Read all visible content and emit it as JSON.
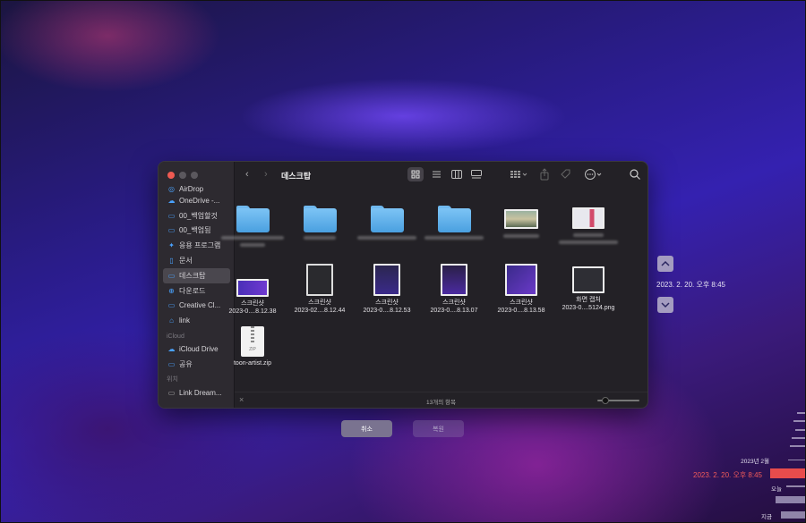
{
  "finder": {
    "title": "데스크탑",
    "sidebar": {
      "favorites": [
        {
          "label": "AirDrop",
          "icon": "airdrop-icon"
        },
        {
          "label": "OneDrive -...",
          "icon": "cloud-icon"
        },
        {
          "label": "00_백업할것",
          "icon": "folder-icon"
        },
        {
          "label": "00_백업됨",
          "icon": "folder-icon"
        },
        {
          "label": "응용 프로그램",
          "icon": "applications-icon"
        },
        {
          "label": "문서",
          "icon": "document-icon"
        },
        {
          "label": "데스크탑",
          "icon": "desktop-icon",
          "selected": true
        },
        {
          "label": "다운로드",
          "icon": "download-icon"
        },
        {
          "label": "Creative Cl...",
          "icon": "folder-icon"
        },
        {
          "label": "link",
          "icon": "home-icon"
        }
      ],
      "icloud_heading": "iCloud",
      "icloud": [
        {
          "label": "iCloud Drive",
          "icon": "cloud-icon"
        },
        {
          "label": "공유",
          "icon": "shared-folder-icon"
        }
      ],
      "locations_heading": "위치",
      "locations": [
        {
          "label": "Link Dream...",
          "icon": "computer-icon"
        }
      ]
    },
    "files_row2": [
      {
        "line1": "스크린샷",
        "line2": "2023-0....8.12.38"
      },
      {
        "line1": "스크린샷",
        "line2": "2023-02....8.12.44"
      },
      {
        "line1": "스크린샷",
        "line2": "2023-0....8.12.53"
      },
      {
        "line1": "스크린샷",
        "line2": "2023-0....8.13.07"
      },
      {
        "line1": "스크린샷",
        "line2": "2023-0....8.13.58"
      },
      {
        "line1": "화면 캡처",
        "line2": "2023-0....5124.png"
      }
    ],
    "zip_file": {
      "label": "toon-artist.zip",
      "badge": "ZIP"
    },
    "status_text": "13개의 항목",
    "icon_size_level": 0.2
  },
  "dialog": {
    "cancel_label": "취소",
    "restore_label": "복원"
  },
  "time_machine": {
    "current_date": "2023. 2. 20. 오후 8:45",
    "timeline": {
      "month_label": "2023년 2월",
      "selected_label": "2023. 2. 20. 오후 8:45",
      "today_label": "오늘",
      "now_label": "지금"
    },
    "accent_color": "#e84c4c"
  }
}
